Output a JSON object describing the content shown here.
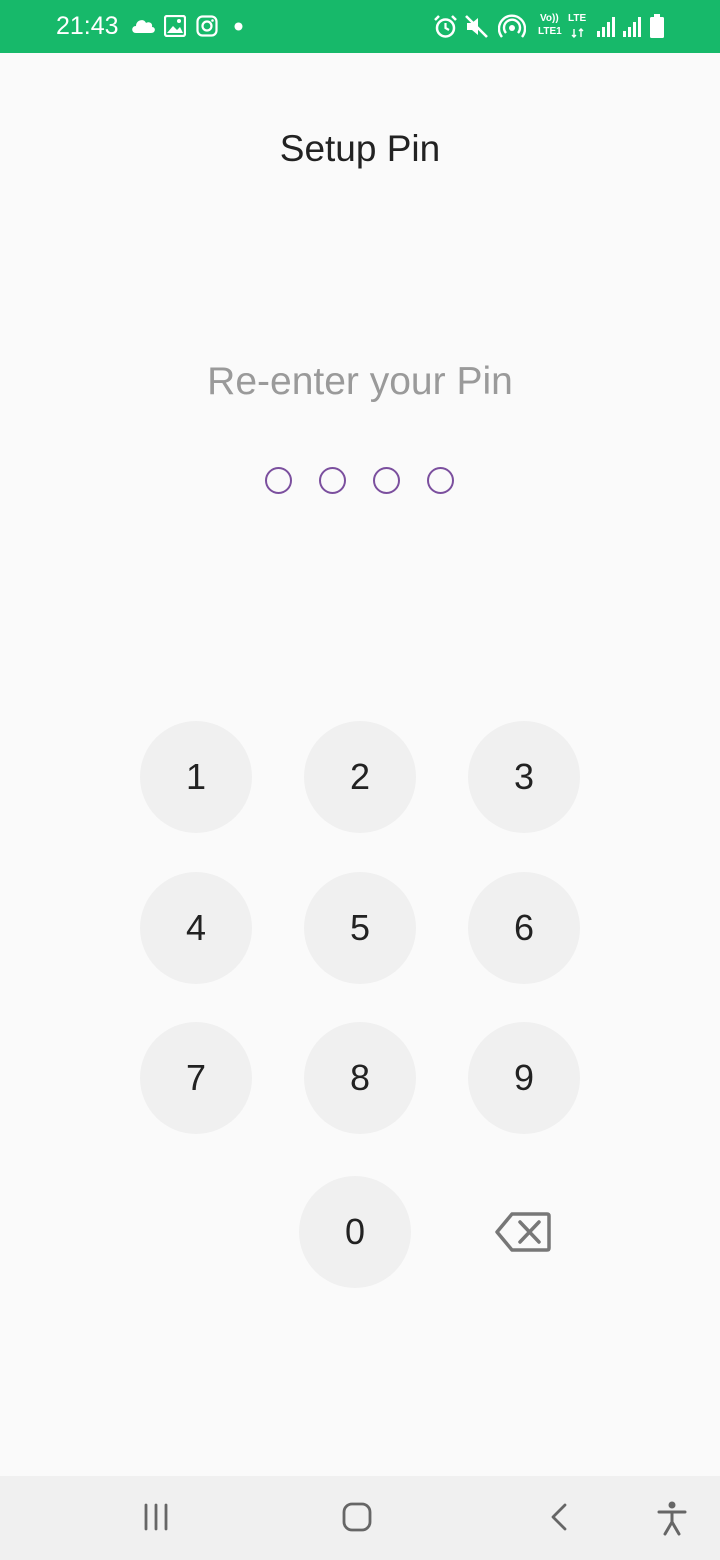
{
  "status_bar": {
    "time": "21:43",
    "volte_label": "Vo))",
    "lte1_label": "LTE1",
    "lte_label": "LTE",
    "background_color": "#17b96a",
    "left_icons": [
      "cloud-icon",
      "gallery-icon",
      "instagram-icon",
      "notification-dot-icon"
    ],
    "right_icons": [
      "alarm-icon",
      "mute-icon",
      "hotspot-icon",
      "volte-lte-icon",
      "signal-icon",
      "signal-icon",
      "battery-icon"
    ]
  },
  "header": {
    "title": "Setup Pin"
  },
  "pin": {
    "prompt": "Re-enter your Pin",
    "length": 4,
    "filled": 0,
    "dot_color": "#7b4f9e"
  },
  "keypad": {
    "keys": [
      "1",
      "2",
      "3",
      "4",
      "5",
      "6",
      "7",
      "8",
      "9",
      "0"
    ],
    "backspace_icon": "backspace-icon"
  },
  "nav_bar": {
    "buttons": [
      "recents-icon",
      "home-icon",
      "back-icon",
      "accessibility-icon"
    ]
  }
}
